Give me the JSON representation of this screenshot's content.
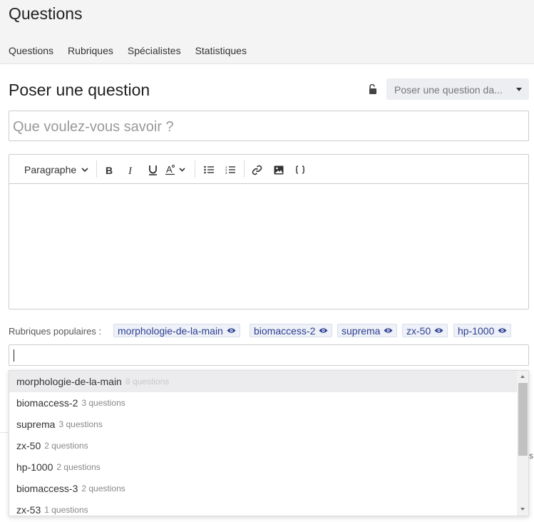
{
  "header": {
    "title": "Questions",
    "nav": [
      "Questions",
      "Rubriques",
      "Spécialistes",
      "Statistiques"
    ]
  },
  "ask": {
    "title": "Poser une question",
    "select_placeholder": "Poser une question da...",
    "title_placeholder": "Que voulez-vous savoir ?"
  },
  "editor": {
    "paragraph_label": "Paragraphe"
  },
  "tags": {
    "popular_label": "Rubriques populaires :",
    "popular": [
      "morphologie-de-la-main",
      "biomaccess-2",
      "suprema",
      "zx-50",
      "hp-1000"
    ]
  },
  "dropdown": {
    "items": [
      {
        "name": "morphologie-de-la-main",
        "count": "8 questions"
      },
      {
        "name": "biomaccess-2",
        "count": "3 questions"
      },
      {
        "name": "suprema",
        "count": "3 questions"
      },
      {
        "name": "zx-50",
        "count": "2 questions"
      },
      {
        "name": "hp-1000",
        "count": "2 questions"
      },
      {
        "name": "biomaccess-3",
        "count": "2 questions"
      },
      {
        "name": "zx-53",
        "count": "1 questions"
      }
    ]
  },
  "edge_text": "s",
  "colors": {
    "tag_text": "#2c3e8f",
    "tag_bg": "#eef1f8",
    "header_bg": "#f4f4f4"
  }
}
